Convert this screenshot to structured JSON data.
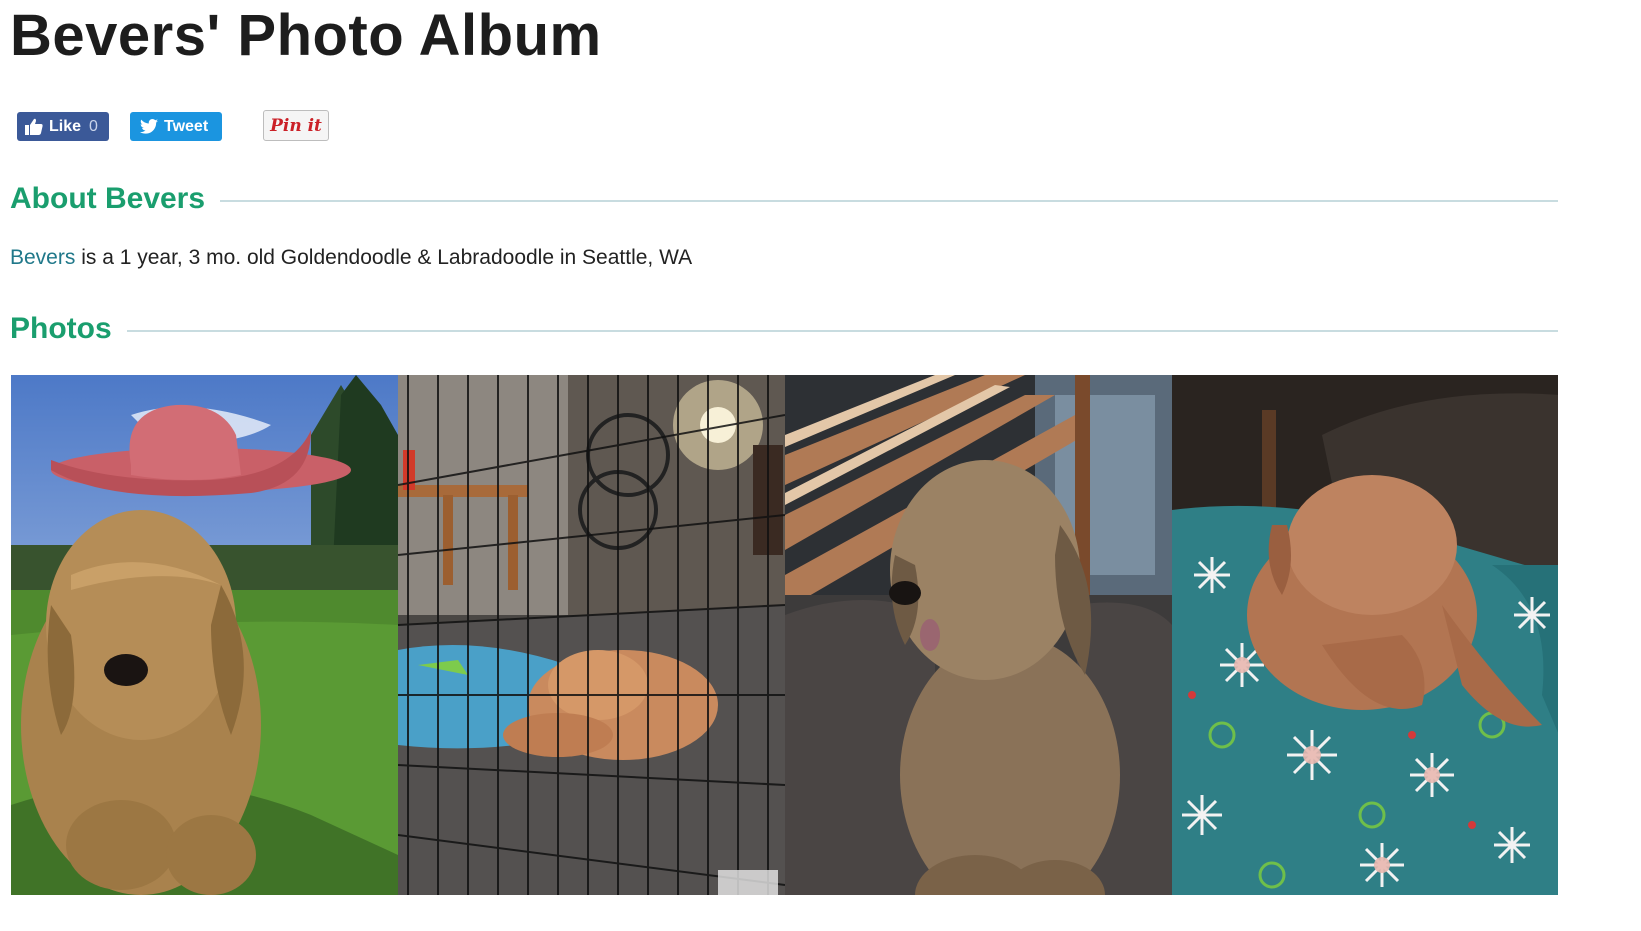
{
  "page": {
    "title": "Bevers' Photo Album"
  },
  "social": {
    "like_label": "Like",
    "like_count": "0",
    "tweet_label": "Tweet",
    "pin_label": "Pin it",
    "colors": {
      "facebook": "#3b5998",
      "twitter": "#1b95e0",
      "pinterest": "#cb2027"
    }
  },
  "about": {
    "heading": "About Bevers",
    "dog_name": "Bevers",
    "description": " is a 1 year, 3 mo. old Goldendoodle & Labradoodle in Seattle, WA"
  },
  "photos": {
    "heading": "Photos",
    "items": [
      {
        "icon": "dog-with-hat-photo"
      },
      {
        "icon": "dog-in-crate-photo"
      },
      {
        "icon": "dog-on-couch-photo"
      },
      {
        "icon": "dog-on-blanket-photo"
      }
    ]
  },
  "theme": {
    "accent": "#1a9e6e",
    "link": "#20788a",
    "rule": "#c8dce0"
  }
}
